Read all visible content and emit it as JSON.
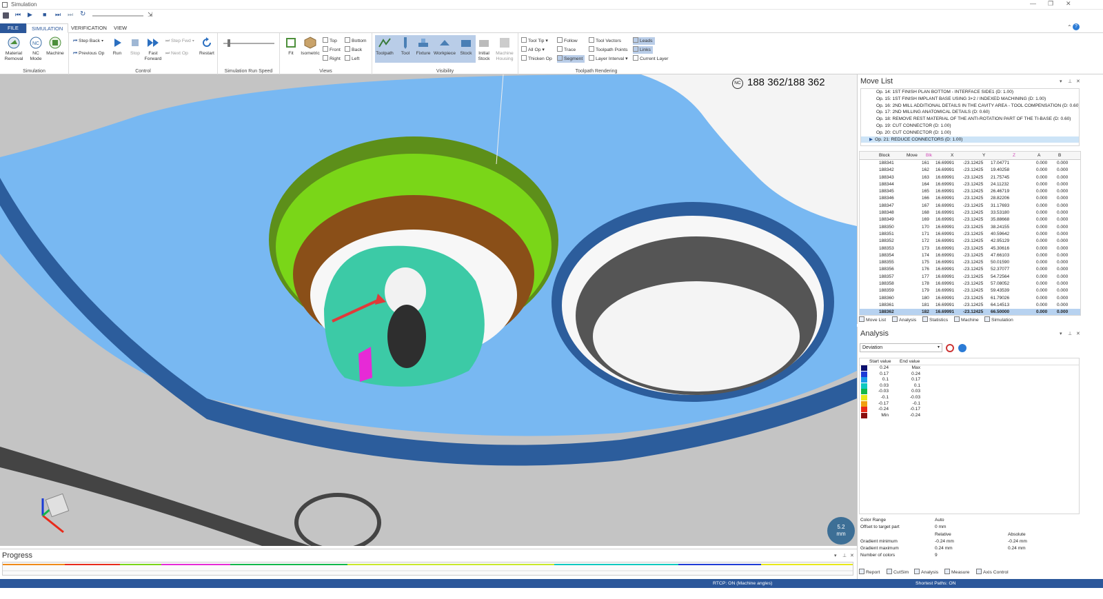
{
  "window": {
    "title": "Simulation"
  },
  "ribbon_tabs": [
    "FILE",
    "SIMULATION",
    "VERIFICATION",
    "VIEW"
  ],
  "groups": {
    "simulation": "Simulation",
    "control": "Control",
    "speed": "Simulation Run Speed",
    "views": "Views",
    "visibility": "Visibility",
    "rendering": "Toolpath Rendering"
  },
  "sim_buttons": {
    "material_removal": "Material Removal",
    "nc_mode": "NC Mode",
    "machine": "Machine"
  },
  "control": {
    "step_back": "Step Back",
    "previous_op": "Previous Op",
    "run": "Run",
    "stop": "Stop",
    "fast_forward": "Fast Forward",
    "step_fwd": "Step Fwd",
    "next_op": "Next Op",
    "restart": "Restart"
  },
  "views": {
    "fit": "Fit",
    "isometric": "Isometric",
    "top": "Top",
    "front": "Front",
    "right": "Right",
    "bottom": "Bottom",
    "back": "Back",
    "left": "Left"
  },
  "visibility": {
    "toolpath": "Toolpath",
    "tool": "Tool",
    "fixture": "Fixture",
    "workpiece": "Workpiece",
    "stock": "Stock",
    "initial_stock": "Initial Stock",
    "machine_housing": "Machine Housing"
  },
  "rendering": {
    "tool_tip": "Tool Tip",
    "all_op": "All Op",
    "thicken_op": "Thicken Op",
    "follow": "Follow",
    "trace": "Trace",
    "segment": "Segment",
    "tool_vectors": "Tool Vectors",
    "toolpath_points": "Toolpath Points",
    "layer_interval": "Layer Interval",
    "leads": "Leads",
    "links": "Links",
    "current_layer": "Current Layer"
  },
  "viewport": {
    "counter": "188 362/188 362",
    "nc_badge": "NC",
    "scale": "5.2",
    "scale_unit": "mm"
  },
  "movelist": {
    "title": "Move List",
    "ops": [
      "Op. 14: 1ST FINISH PLAN BOTTOM - INTERFACE SIDE1 (D: 1.00)",
      "Op. 15: 1ST FINISH IMPLANT BASE USING 3+2 / INDEXED MACHINING (D: 1.00)",
      "Op. 16: 2ND MILL ADDITIONAL DETAILS IN THE CAVITY AREA - TOOL COMPENSATION (D: 0.60)",
      "Op. 17: 2ND MILLING ANATOMICAL DETAILS (D: 0.60)",
      "Op. 18: REMOVE REST MATERIAL OF THE ANTI-ROTATION PART OF THE TI-BASE (D: 0.60)",
      "Op. 19: CUT CONNECTOR (D: 1.00)",
      "Op. 20: CUT CONNECTOR (D: 1.00)",
      "Op. 21: REDUCE CONNECTORS (D: 1.00)"
    ],
    "columns": [
      "Block",
      "Move",
      "Blk",
      "X",
      "Y",
      "Z",
      "A",
      "B"
    ],
    "rows": [
      [
        "188341",
        "161",
        "16.69991",
        "-23.12425",
        "17.04771",
        "0.000",
        "0.000"
      ],
      [
        "188342",
        "162",
        "16.69991",
        "-23.12425",
        "19.40258",
        "0.000",
        "0.000"
      ],
      [
        "188343",
        "163",
        "16.69991",
        "-23.12425",
        "21.75745",
        "0.000",
        "0.000"
      ],
      [
        "188344",
        "164",
        "16.69991",
        "-23.12425",
        "24.11232",
        "0.000",
        "0.000"
      ],
      [
        "188345",
        "165",
        "16.69991",
        "-23.12425",
        "26.46719",
        "0.000",
        "0.000"
      ],
      [
        "188346",
        "166",
        "16.69991",
        "-23.12425",
        "28.82206",
        "0.000",
        "0.000"
      ],
      [
        "188347",
        "167",
        "16.69991",
        "-23.12425",
        "31.17693",
        "0.000",
        "0.000"
      ],
      [
        "188348",
        "168",
        "16.69991",
        "-23.12425",
        "33.53180",
        "0.000",
        "0.000"
      ],
      [
        "188349",
        "169",
        "16.69991",
        "-23.12425",
        "35.88668",
        "0.000",
        "0.000"
      ],
      [
        "188350",
        "170",
        "16.69991",
        "-23.12425",
        "38.24155",
        "0.000",
        "0.000"
      ],
      [
        "188351",
        "171",
        "16.69991",
        "-23.12425",
        "40.59642",
        "0.000",
        "0.000"
      ],
      [
        "188352",
        "172",
        "16.69991",
        "-23.12425",
        "42.95129",
        "0.000",
        "0.000"
      ],
      [
        "188353",
        "173",
        "16.69991",
        "-23.12425",
        "45.30616",
        "0.000",
        "0.000"
      ],
      [
        "188354",
        "174",
        "16.69991",
        "-23.12425",
        "47.66103",
        "0.000",
        "0.000"
      ],
      [
        "188355",
        "175",
        "16.69991",
        "-23.12425",
        "50.01590",
        "0.000",
        "0.000"
      ],
      [
        "188356",
        "176",
        "16.69991",
        "-23.12425",
        "52.37077",
        "0.000",
        "0.000"
      ],
      [
        "188357",
        "177",
        "16.69991",
        "-23.12425",
        "54.72564",
        "0.000",
        "0.000"
      ],
      [
        "188358",
        "178",
        "16.69991",
        "-23.12425",
        "57.08052",
        "0.000",
        "0.000"
      ],
      [
        "188359",
        "179",
        "16.69991",
        "-23.12425",
        "59.43539",
        "0.000",
        "0.000"
      ],
      [
        "188360",
        "180",
        "16.69991",
        "-23.12425",
        "61.79026",
        "0.000",
        "0.000"
      ],
      [
        "188361",
        "181",
        "16.69991",
        "-23.12425",
        "64.14513",
        "0.000",
        "0.000"
      ],
      [
        "188362",
        "182",
        "16.69991",
        "-23.12425",
        "66.50000",
        "0.000",
        "0.000"
      ]
    ],
    "tabs": [
      "Move List",
      "Analysis",
      "Statistics",
      "Machine",
      "Simulation"
    ]
  },
  "analysis": {
    "title": "Analysis",
    "mode": "Deviation",
    "columns": [
      "Start value",
      "End value"
    ],
    "legend": [
      {
        "color": "#0b0f6e",
        "start": "0.24",
        "end": "Max"
      },
      {
        "color": "#1f3bd6",
        "start": "0.17",
        "end": "0.24"
      },
      {
        "color": "#1c9ae8",
        "start": "0.1",
        "end": "0.17"
      },
      {
        "color": "#10c9c0",
        "start": "0.03",
        "end": "0.1"
      },
      {
        "color": "#12b84a",
        "start": "-0.03",
        "end": "0.03"
      },
      {
        "color": "#e8e818",
        "start": "-0.1",
        "end": "-0.03"
      },
      {
        "color": "#f0a010",
        "start": "-0.17",
        "end": "-0.1"
      },
      {
        "color": "#e82a1a",
        "start": "-0.24",
        "end": "-0.17"
      },
      {
        "color": "#8a0c0c",
        "start": "Min",
        "end": "-0.24"
      }
    ],
    "props": [
      {
        "label": "Color Range",
        "v1": "Auto",
        "v2": ""
      },
      {
        "label": "Offset to target part",
        "v1": "0 mm",
        "v2": ""
      },
      {
        "label": "",
        "v1": "Relative",
        "v2": "Absolute"
      },
      {
        "label": "Gradient minimum",
        "v1": "-0.24 mm",
        "v2": "-0.24 mm"
      },
      {
        "label": "Gradient maximum",
        "v1": "0.24 mm",
        "v2": "0.24 mm"
      },
      {
        "label": "Number of colors",
        "v1": "9",
        "v2": ""
      }
    ],
    "tabs": [
      "Report",
      "CutSim",
      "Analysis",
      "Measure",
      "Axis Control"
    ]
  },
  "progress": {
    "title": "Progress"
  },
  "status": {
    "rtcp": "RTCP: ON (Machine angles)",
    "paths": "Shortest Paths: ON"
  }
}
